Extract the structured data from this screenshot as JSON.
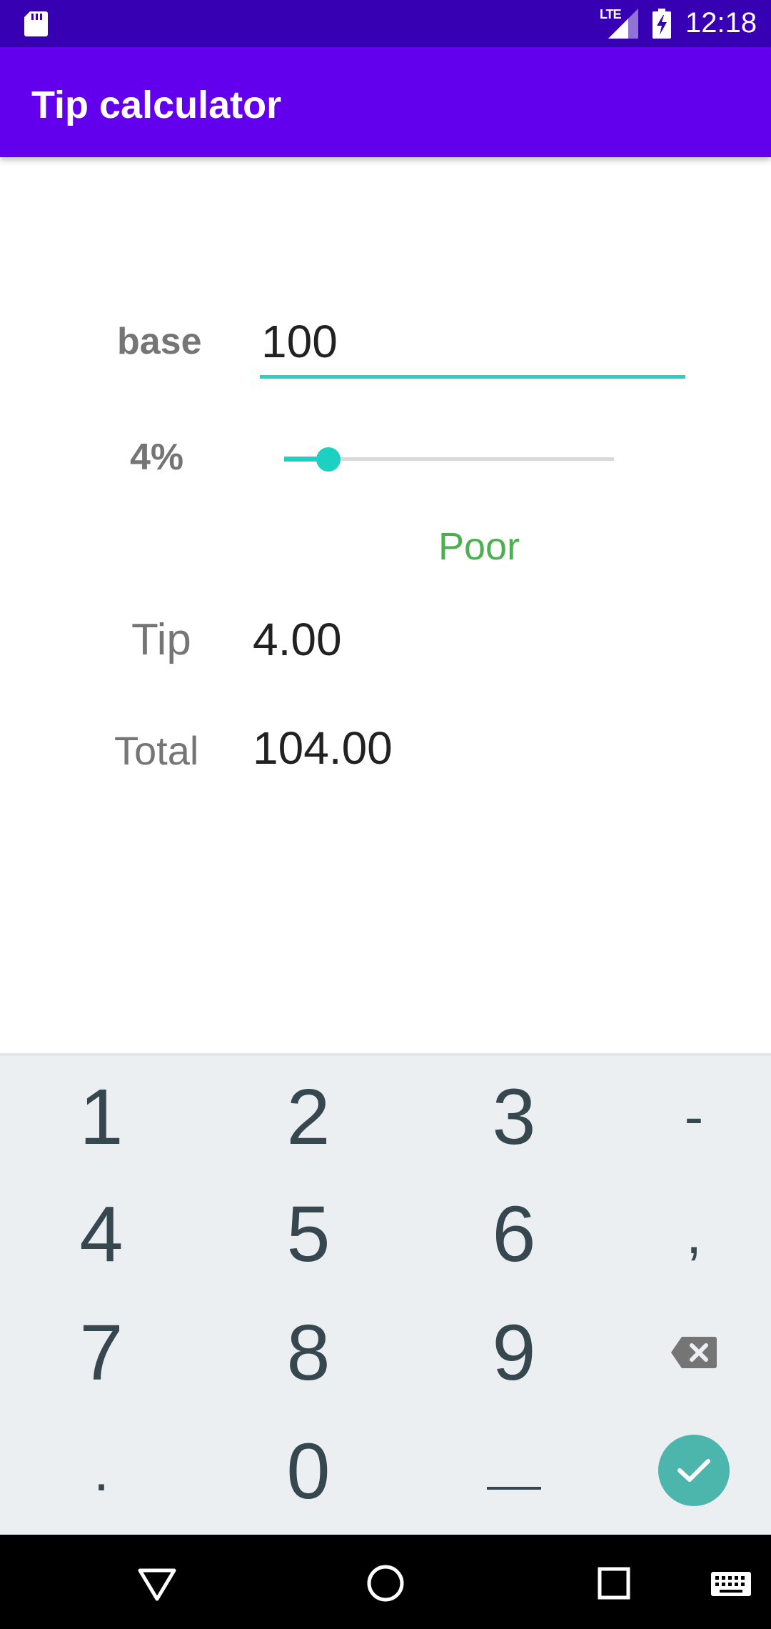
{
  "status_bar": {
    "time": "12:18",
    "network": "LTE",
    "icons": [
      "sd-card-icon",
      "signal-icon",
      "battery-charging-icon"
    ]
  },
  "app_bar": {
    "title": "Tip calculator"
  },
  "form": {
    "base_label": "base",
    "base_value": "100",
    "percent_label": "4%",
    "tip_percent": 4,
    "slider_max": 30,
    "rating": "Poor",
    "tip_label": "Tip",
    "tip_value": "4.00",
    "total_label": "Total",
    "total_value": "104.00"
  },
  "keyboard": {
    "keys": [
      [
        "1",
        "2",
        "3",
        "-"
      ],
      [
        "4",
        "5",
        "6",
        ","
      ],
      [
        "7",
        "8",
        "9",
        "backspace-icon"
      ],
      [
        ".",
        "0",
        "_",
        "done-icon"
      ]
    ]
  },
  "colors": {
    "status_bar": "#3700b3",
    "app_bar": "#6200ee",
    "accent": "#1cd1c1",
    "rating": "#4caf50",
    "keyboard_bg": "#eceff1",
    "done_key": "#4db6ac"
  },
  "nav_bar": {
    "icons": [
      "back-icon",
      "home-icon",
      "recents-icon",
      "keyboard-icon"
    ]
  }
}
